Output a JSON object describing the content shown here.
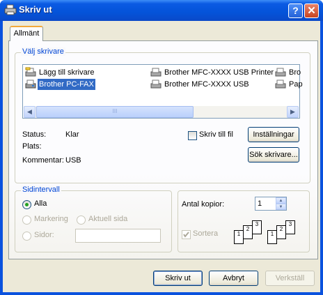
{
  "window": {
    "title": "Skriv ut"
  },
  "tabs": [
    {
      "label": "Allmänt"
    }
  ],
  "printer_group": {
    "legend": "Välj skrivare",
    "printers": [
      {
        "label": "Lägg till skrivare",
        "icon": "add-printer-icon"
      },
      {
        "label": "Brother PC-FAX",
        "icon": "fax-printer-icon",
        "selected": true
      },
      {
        "label": "Brother MFC-XXXX  USB Printer",
        "icon": "printer-icon"
      },
      {
        "label": "Brother MFC-XXXX  USB",
        "icon": "printer-icon"
      },
      {
        "label": "Bro",
        "icon": "printer-icon"
      },
      {
        "label": "Pap",
        "icon": "printer-icon"
      }
    ],
    "scroll_grip": "III",
    "status_label": "Status:",
    "status_value": "Klar",
    "location_label": "Plats:",
    "location_value": "",
    "comment_label": "Kommentar:",
    "comment_value": "USB",
    "print_to_file_label": "Skriv till fil",
    "preferences_button": "Inställningar",
    "find_printer_button": "Sök skrivare..."
  },
  "page_range": {
    "legend": "Sidintervall",
    "all_label": "Alla",
    "selection_label": "Markering",
    "current_page_label": "Aktuell sida",
    "pages_label": "Sidor:",
    "pages_value": ""
  },
  "copies": {
    "count_label": "Antal kopior:",
    "count_value": "1",
    "collate_label": "Sortera",
    "collate_pages": [
      "1",
      "2",
      "3"
    ]
  },
  "buttons": {
    "print": "Skriv ut",
    "cancel": "Avbryt",
    "apply": "Verkställ"
  },
  "colors": {
    "titlebar": "#0453d9",
    "selection": "#316ac5",
    "legend": "#0046d5",
    "dialog_bg": "#ece9d8"
  }
}
